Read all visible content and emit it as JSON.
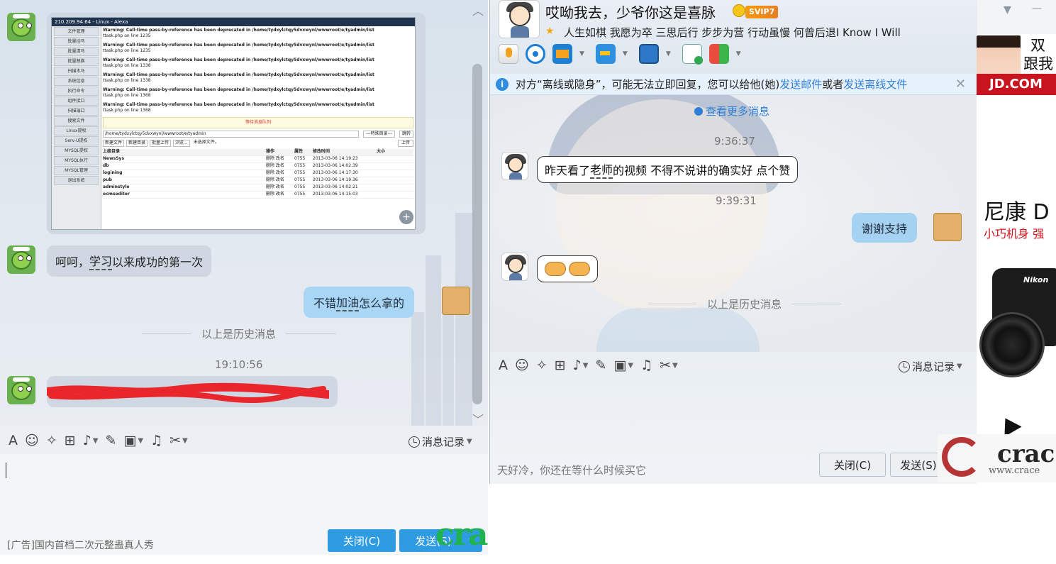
{
  "left": {
    "thumbnail": {
      "title": "210.209.94.64 - Linux - Alexa",
      "menu": [
        "文件管理",
        "批量挂马",
        "批量清马",
        "批量替换",
        "扫描木马",
        "系统信息",
        "执行命令",
        "组件接口",
        "扫描端口",
        "搜索文件",
        "Linux提权",
        "Serv-U提权",
        "MYSQL提权",
        "MYSQL执行",
        "MYSQL管理",
        "退出系统"
      ],
      "warnings": [
        {
          "line": "Warning: Call-time pass-by-reference has been deprecated in /home/tydxylctqy5dvxwynl/wwwroot/e/tyadmin/list",
          "file": "ttask.php on line 1235"
        },
        {
          "line": "Warning: Call-time pass-by-reference has been deprecated in /home/tydxylctqy5dvxwynl/wwwroot/e/tyadmin/list",
          "file": "ttask.php on line 1235"
        },
        {
          "line": "Warning: Call-time pass-by-reference has been deprecated in /home/tydxylctqy5dvxwynl/wwwroot/e/tyadmin/list",
          "file": "ttask.php on line 1338"
        },
        {
          "line": "Warning: Call-time pass-by-reference has been deprecated in /home/tydxylctqy5dvxwynl/wwwroot/e/tyadmin/list",
          "file": "ttask.php on line 1338"
        },
        {
          "line": "Warning: Call-time pass-by-reference has been deprecated in /home/tydxylctqy5dvxwynl/wwwroot/e/tyadmin/list",
          "file": "ttask.php on line 1368"
        },
        {
          "line": "Warning: Call-time pass-by-reference has been deprecated in /home/tydxylctqy5dvxwynl/wwwroot/e/tyadmin/list",
          "file": "ttask.php on line 1368"
        }
      ],
      "yellow_bar": "等待消息队列",
      "path": "/home/tydxylctqy5dvxwynl/wwwroot/e/tyadmin",
      "buttons": [
        "新建文件",
        "新建目录",
        "批量上传",
        "浏览...",
        "未选择文件。"
      ],
      "select": "---特殊目录---",
      "go": "跳转",
      "upload": "上传",
      "table_headers": [
        "上级目录",
        "操作",
        "属性",
        "修改时间",
        "大小"
      ],
      "rows": [
        [
          "NewsSys",
          "删除 改名",
          "0755",
          "2013-03-06 14:19:23"
        ],
        [
          "db",
          "删除 改名",
          "0755",
          "2013-03-06 14:02:39"
        ],
        [
          "logining",
          "删除 改名",
          "0755",
          "2013-03-06 14:17:30"
        ],
        [
          "pub",
          "删除 改名",
          "0755",
          "2013-03-06 14:19:36"
        ],
        [
          "adminstyle",
          "删除 改名",
          "0755",
          "2013-03-06 14:02:21"
        ],
        [
          "ecmseditor",
          "删除 改名",
          "0755",
          "2013-03-06 14:15:03"
        ]
      ]
    },
    "msg1_pre": "呵呵，",
    "msg1_u": "学习",
    "msg1_post": "以来成功的第一次",
    "msg2_pre": "不错 ",
    "msg2_u": "加油",
    "msg2_post": " 怎么拿的",
    "history_label": "以上是历史消息",
    "timestamp": "19:10:56",
    "history_button": "消息记录",
    "ad_text": "[广告]国内首档二次元整蛊真人秀",
    "close_button": "关闭(C)",
    "send_button": "发送(S)",
    "watermark": "crac"
  },
  "right": {
    "contact_name": "哎呦我去，少爷你这是喜脉",
    "vip_badge": "SVIP7",
    "signature": "人生如棋 我愿为卒 三思后行 步步为营 行动虽慢 何曾后退I Know I Will",
    "notice_pre": "对方“离线或隐身”，可能无法立即回复，您可以给他(她)",
    "notice_link1": "发送邮件",
    "notice_mid": "或者",
    "notice_link2": "发送离线文件",
    "more_messages": "查看更多消息",
    "time1": "9:36:37",
    "msg1_pre": "昨天看了",
    "msg1_u": "老师",
    "msg1_post": "的视频 不得不说讲的确实好 点个赞",
    "time2": "9:39:31",
    "msg2": "谢谢支持",
    "history_label": "以上是历史消息",
    "history_button": "消息记录",
    "input_hint": "天好冷，你还在等什么时候买它",
    "close_button": "关闭(C)",
    "send_button": "发送(S)"
  },
  "ad": {
    "line1": "双",
    "line2": "跟我",
    "jd": "JD.COM",
    "nikon_title": "尼康 D",
    "nikon_sub": "小巧机身 强",
    "nikon_brand": "Nikon"
  },
  "craceo": {
    "word": "crac",
    "url": "www.crace"
  },
  "colors": {
    "accent_blue": "#2e9be2",
    "link_blue": "#2f7fd6",
    "jd_red": "#c8141e",
    "vip_orange": "#f39c12"
  }
}
